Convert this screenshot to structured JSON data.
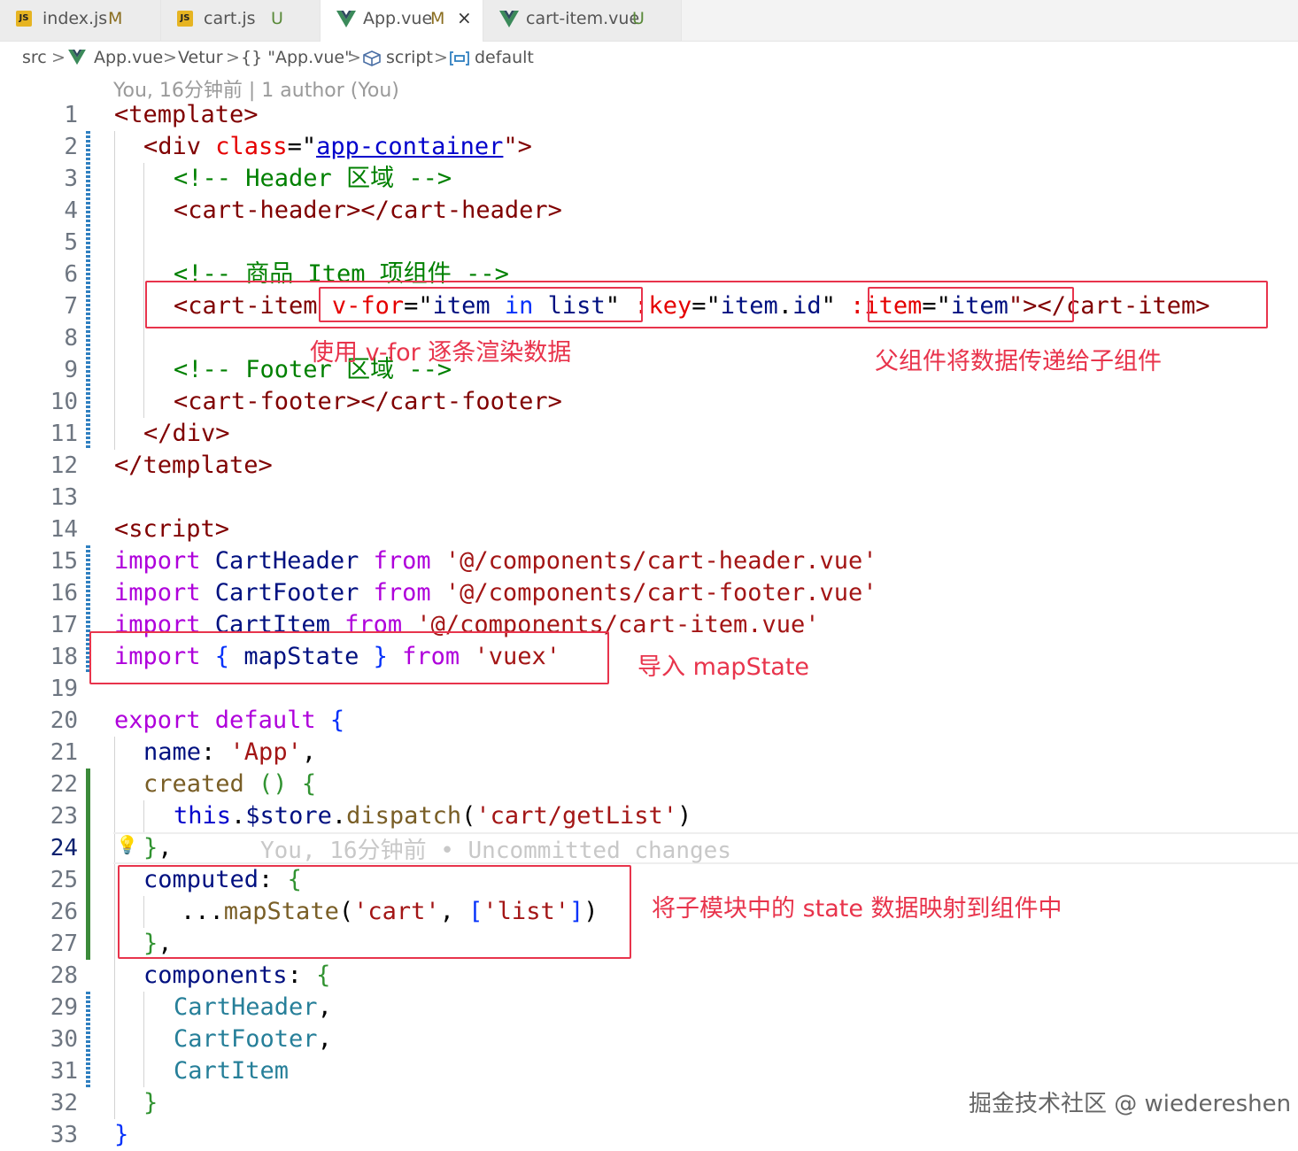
{
  "tabs": [
    {
      "icon": "js-file-icon",
      "icon_text": "JS",
      "name": "index.js",
      "status": "M"
    },
    {
      "icon": "js-file-icon",
      "icon_text": "JS",
      "name": "cart.js",
      "status": "U"
    },
    {
      "icon": "vue-file-icon",
      "name": "App.vue",
      "status": "M",
      "active": true,
      "close": "×"
    },
    {
      "icon": "vue-file-icon",
      "name": "cart-item.vue",
      "status": "U"
    }
  ],
  "breadcrumb": {
    "src": "src",
    "file": "App.vue",
    "vetur": "Vetur",
    "obj": "{} \"App.vue\"",
    "script": "script",
    "default": "default",
    "sep": ">"
  },
  "blame_header": "You, 16分钟前 | 1 author (You)",
  "lines": [
    "1",
    "2",
    "3",
    "4",
    "5",
    "6",
    "7",
    "8",
    "9",
    "10",
    "11",
    "12",
    "13",
    "14",
    "15",
    "16",
    "17",
    "18",
    "19",
    "20",
    "21",
    "22",
    "23",
    "24",
    "25",
    "26",
    "27",
    "28",
    "29",
    "30",
    "31",
    "32",
    "33"
  ],
  "code": {
    "l1": "<template>",
    "l2a": "<div ",
    "l2b": "class",
    "l2c": "=\"",
    "l2d": "app-container",
    "l2e": "\">",
    "l3": "<!-- Header 区域 -->",
    "l4": "<cart-header></cart-header>",
    "l6": "<!-- 商品 Item 项组件 -->",
    "l7a": "<cart-item ",
    "l7b": "v-for",
    "l7c": "=\"",
    "l7d": "item",
    "l7e": " in ",
    "l7f": "list",
    "l7g": "\" ",
    "l7h": ":key",
    "l7i": "=\"",
    "l7j": "item",
    "l7k": ".",
    "l7l": "id",
    "l7m": "\" ",
    "l7n": ":item",
    "l7o": "=\"",
    "l7p": "item",
    "l7q": "\">",
    "l7r": "</cart-item>",
    "l9": "<!-- Footer 区域 -->",
    "l10": "<cart-footer></cart-footer>",
    "l11": "</div>",
    "l12": "</template>",
    "l14": "<script>",
    "l15a": "import",
    "l15b": " CartHeader ",
    "l15c": "from",
    "l15d": " '@/components/cart-header.vue'",
    "l16a": "import",
    "l16b": " CartFooter ",
    "l16c": "from",
    "l16d": " '@/components/cart-footer.vue'",
    "l17a": "import",
    "l17b": " CartItem ",
    "l17c": "from",
    "l17d": " '@/components/cart-item.vue'",
    "l18a": "import",
    "l18b": " { ",
    "l18c": "mapState",
    "l18d": " } ",
    "l18e": "from",
    "l18f": " 'vuex'",
    "l20a": "export",
    "l20b": " default ",
    "l20c": "{",
    "l21a": "name",
    "l21b": ": ",
    "l21c": "'App'",
    "l21d": ",",
    "l22a": "created",
    "l22b": " () ",
    "l22c": "{",
    "l23a": "this",
    "l23b": ".",
    "l23c": "$store",
    "l23d": ".",
    "l23e": "dispatch",
    "l23f": "(",
    "l23g": "'cart/getList'",
    "l23h": ")",
    "l24a": "}",
    "l24b": ",",
    "l25a": "computed",
    "l25b": ": ",
    "l25c": "{",
    "l26a": "...",
    "l26b": "mapState",
    "l26c": "(",
    "l26d": "'cart'",
    "l26e": ", ",
    "l26f": "[",
    "l26g": "'list'",
    "l26h": "]",
    "l26i": ")",
    "l27a": "}",
    "l27b": ",",
    "l28a": "components",
    "l28b": ": ",
    "l28c": "{",
    "l29": "CartHeader",
    "l29b": ",",
    "l30": "CartFooter",
    "l30b": ",",
    "l31": "CartItem",
    "l32": "}",
    "l33": "}"
  },
  "blame_inline": "You, 16分钟前 • Uncommitted changes",
  "annotations": {
    "vfor": "使用 v-for 逐条渲染数据",
    "props": "父组件将数据传递给子组件",
    "import": "导入 mapState",
    "mapstate": "将子模块中的 state 数据映射到组件中"
  },
  "watermark": "掘金技术社区 @ wiedereshen",
  "colors": {
    "annotation": "#e8344c",
    "tag": "#800000",
    "attr": "#e50000",
    "string": "#0000cc",
    "comment": "#008000",
    "keyword": "#af00db",
    "variable": "#001080",
    "class": "#267f99",
    "js_string": "#a31515",
    "function": "#795e26"
  }
}
